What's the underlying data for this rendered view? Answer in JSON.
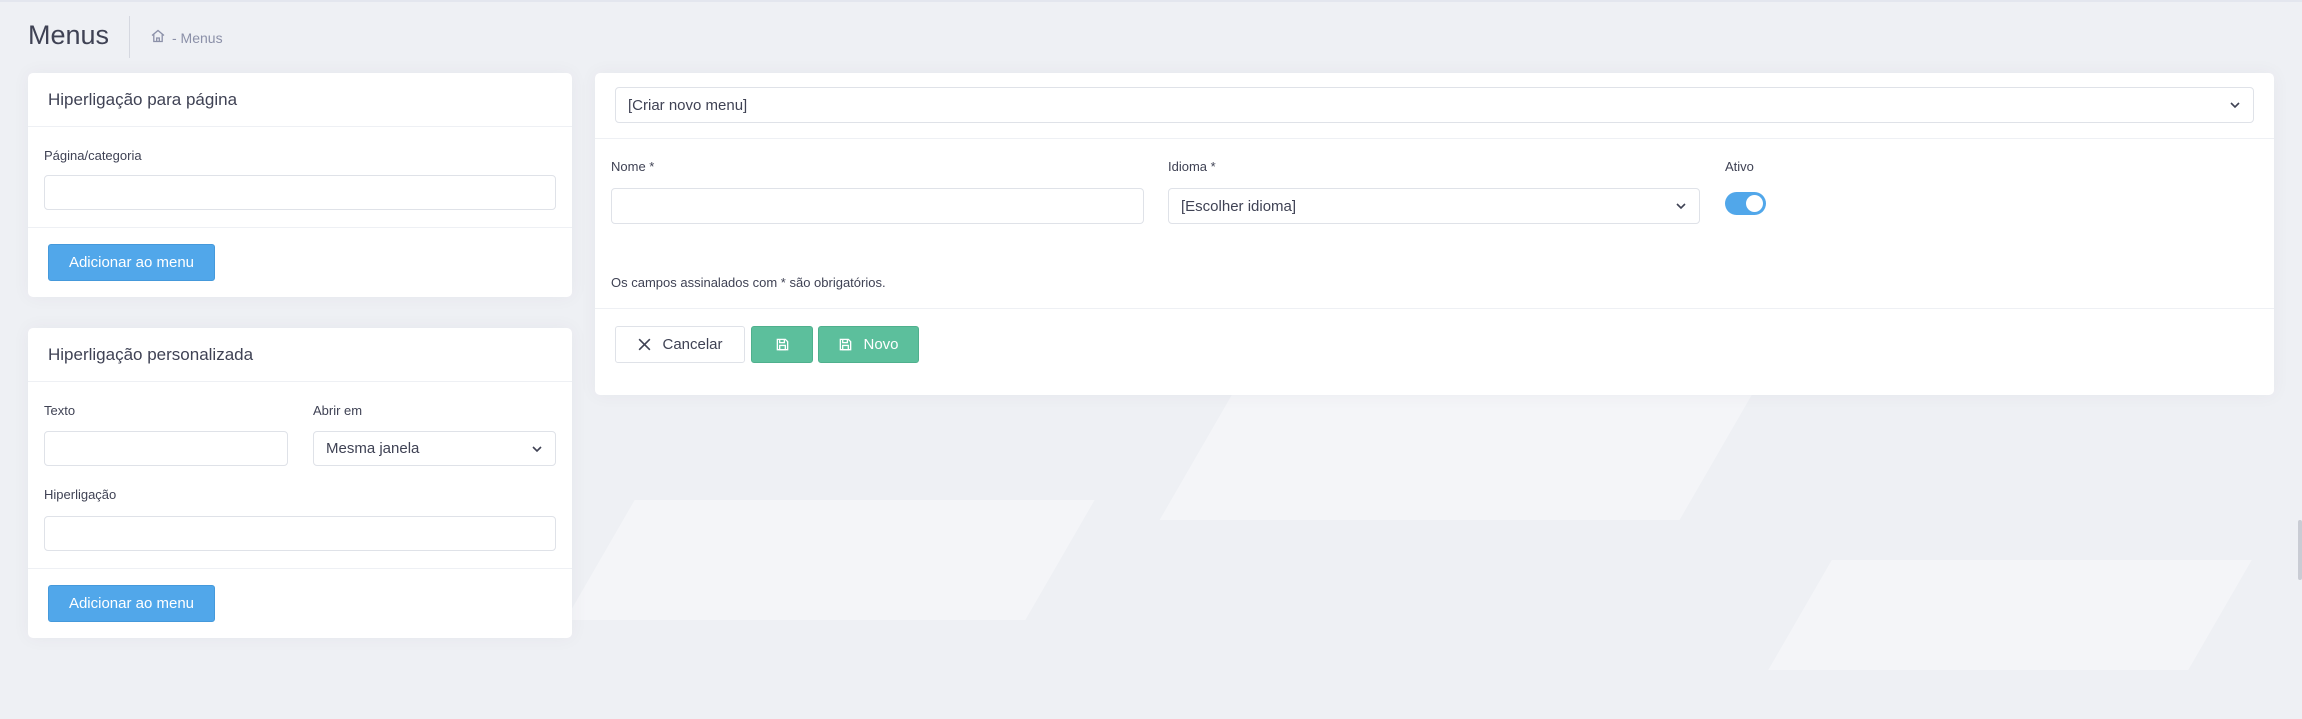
{
  "page": {
    "title": "Menus",
    "breadcrumb": "- Menus"
  },
  "page_link_card": {
    "title": "Hiperligação para página",
    "field_label": "Página/categoria",
    "field_value": "",
    "add_button": "Adicionar ao menu"
  },
  "custom_link_card": {
    "title": "Hiperligação personalizada",
    "text_label": "Texto",
    "text_value": "",
    "open_label": "Abrir em",
    "open_value": "Mesma janela",
    "link_label": "Hiperligação",
    "link_value": "",
    "add_button": "Adicionar ao menu"
  },
  "menu_card": {
    "menu_select": "[Criar novo menu]",
    "name_label": "Nome *",
    "name_value": "",
    "language_label": "Idioma *",
    "language_value": "[Escolher idioma]",
    "active_label": "Ativo",
    "active": true,
    "required_note": "Os campos assinalados com * são obrigatórios.",
    "cancel_button": "Cancelar",
    "new_button": "Novo"
  },
  "colors": {
    "primary": "#51a7ea",
    "success": "#5cbf9c",
    "background": "#eef0f4"
  },
  "icons": {
    "breadcrumb": "home-icon",
    "select": "chevron-down-icon",
    "cancel": "close-icon",
    "save": "floppy-disk-icon"
  }
}
